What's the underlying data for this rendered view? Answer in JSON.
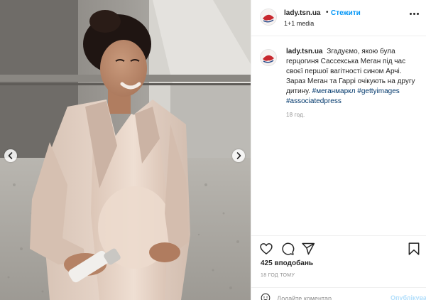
{
  "header": {
    "username": "lady.tsn.ua",
    "dot": "•",
    "follow_label": "Стежити",
    "subtitle": "1+1 media"
  },
  "caption": {
    "username": "lady.tsn.ua",
    "text": "Згадуємо, якою була герцогиня Сассекська Меган під час своєї першої вагітності сином Арчі. Зараз Меган та Гаррі очікують на другу дитину.",
    "hashtags": [
      "#меганмаркл",
      "#gettyimages",
      "#associatedpress"
    ],
    "age": "18 год."
  },
  "engagement": {
    "likes": "425 вподобань",
    "timestamp": "18 год тому"
  },
  "comment": {
    "placeholder": "Додайте коментар...",
    "publish_label": "Опублікувати"
  },
  "icons": {
    "like": "heart-icon",
    "comment": "comment-icon",
    "share": "share-icon",
    "save": "bookmark-icon",
    "more": "more-options-icon",
    "prev": "chevron-left-icon",
    "next": "chevron-right-icon",
    "emoji": "emoji-icon"
  },
  "colors": {
    "link": "#0095f6",
    "hashtag": "#00376b",
    "text": "#262626",
    "muted": "#8e8e8e",
    "publish_disabled": "#b2dffc"
  }
}
